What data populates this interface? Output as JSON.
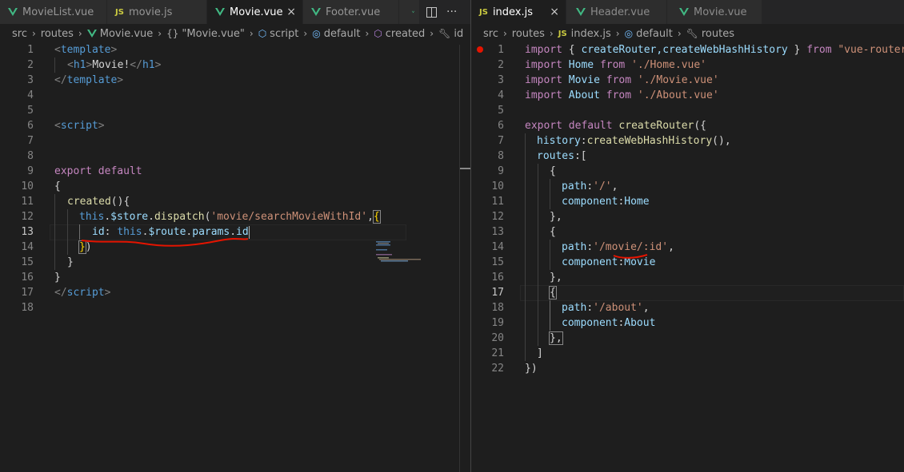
{
  "left": {
    "tabs": [
      {
        "label": "MovieList.vue",
        "icon": "vue-icon",
        "active": false
      },
      {
        "label": "movie.js",
        "icon": "js-icon",
        "active": false
      },
      {
        "label": "Movie.vue",
        "icon": "vue-icon",
        "active": true
      },
      {
        "label": "Footer.vue",
        "icon": "vue-icon",
        "active": false
      }
    ],
    "close_glyph": "×",
    "more_glyph": "···",
    "breadcrumb": [
      "src",
      "routes",
      "Movie.vue",
      "\"Movie.vue\"",
      "script",
      "default",
      "created",
      "id"
    ],
    "breadcrumb_icons": [
      "",
      "",
      "vue-icon",
      "braces-icon",
      "cube-icon",
      "symbol-icon",
      "cube-icon",
      "wrench-icon"
    ],
    "line_numbers": [
      "1",
      "2",
      "3",
      "4",
      "5",
      "6",
      "7",
      "8",
      "9",
      "10",
      "11",
      "12",
      "13",
      "14",
      "15",
      "16",
      "17",
      "18"
    ],
    "code": {
      "l1_open": "<",
      "l1_tag": "template",
      "l1_close": ">",
      "l2_open": "<",
      "l2_tag": "h1",
      "l2_close": ">",
      "l2_text": "Movie!",
      "l2_open2": "</",
      "l2_tag2": "h1",
      "l2_close2": ">",
      "l3_open": "</",
      "l3_tag": "template",
      "l3_close": ">",
      "l6_open": "<",
      "l6_tag": "script",
      "l6_close": ">",
      "l9_kw": "export",
      "l9_kw2": "default",
      "l10": "{",
      "l11_fn": "created",
      "l11_rest": "(){",
      "l12_this": "this",
      "l12_dot": ".",
      "l12_store": "$store",
      "l12_dot2": ".",
      "l12_fn": "dispatch",
      "l12_paren": "(",
      "l12_str": "'movie/searchMovieWithId'",
      "l12_comma": ",",
      "l12_brace": "{",
      "l13_key": "id",
      "l13_colon": ": ",
      "l13_this": "this",
      "l13_dot": ".",
      "l13_route": "$route",
      "l13_dot2": ".",
      "l13_params": "params",
      "l13_dot3": ".",
      "l13_id": "id",
      "l14_brace": "}",
      "l14_paren": ")",
      "l15": "}",
      "l16": "}",
      "l17_open": "</",
      "l17_tag": "script",
      "l17_close": ">"
    }
  },
  "right": {
    "tabs": [
      {
        "label": "index.js",
        "icon": "js-icon",
        "active": true
      },
      {
        "label": "Header.vue",
        "icon": "vue-icon",
        "active": false
      },
      {
        "label": "Movie.vue",
        "icon": "vue-icon",
        "active": false
      }
    ],
    "close_glyph": "×",
    "breadcrumb": [
      "src",
      "routes",
      "index.js",
      "default",
      "routes"
    ],
    "breadcrumb_icons": [
      "",
      "",
      "js-icon",
      "symbol-icon",
      "wrench-icon"
    ],
    "js_badge": "JS",
    "line_numbers": [
      "1",
      "2",
      "3",
      "4",
      "5",
      "6",
      "7",
      "8",
      "9",
      "10",
      "11",
      "12",
      "13",
      "14",
      "15",
      "16",
      "17",
      "18",
      "19",
      "20",
      "21",
      "22"
    ],
    "code": {
      "l1_kw": "import",
      "l1_b": " { ",
      "l1_v": "createRouter,createWebHashHistory",
      "l1_b2": " } ",
      "l1_from": "from",
      "l1_str": " \"vue-router\"",
      "l2_kw": "import",
      "l2_v": " Home ",
      "l2_from": "from",
      "l2_str": " './Home.vue'",
      "l3_kw": "import",
      "l3_v": " Movie ",
      "l3_from": "from",
      "l3_str": " './Movie.vue'",
      "l4_kw": "import",
      "l4_v": " About ",
      "l4_from": "from",
      "l4_str": " './About.vue'",
      "l6_kw": "export",
      "l6_kw2": " default ",
      "l6_fn": "createRouter",
      "l6_p": "({",
      "l7_key": "history",
      "l7_c": ":",
      "l7_fn": "createWebHashHistory",
      "l7_p": "(),",
      "l8_key": "routes",
      "l8_c": ":[",
      "l9": "{",
      "l10_key": "path",
      "l10_c": ":",
      "l10_str": "'/'",
      "l10_comma": ",",
      "l11_key": "component",
      "l11_c": ":",
      "l11_v": "Home",
      "l12": "},",
      "l13": "{",
      "l14_key": "path",
      "l14_c": ":",
      "l14_str1": "'/movie/",
      "l14_str2": ":id",
      "l14_str3": "'",
      "l14_comma": ",",
      "l15_key": "component",
      "l15_c": ":",
      "l15_v": "Movie",
      "l16": "},",
      "l17": "{",
      "l18_key": "path",
      "l18_c": ":",
      "l18_str": "'/about'",
      "l18_comma": ",",
      "l19_key": "component",
      "l19_c": ":",
      "l19_v": "About",
      "l20": "},",
      "l21": "]",
      "l22": "})"
    }
  },
  "colors": {
    "background": "#1e1e1e",
    "tab_inactive": "#2d2d2d",
    "keyword": "#c586c0",
    "tag": "#569cd6",
    "function": "#dcdcaa",
    "variable": "#9cdcfe",
    "string": "#ce9178",
    "annotation_red": "#e51400"
  }
}
